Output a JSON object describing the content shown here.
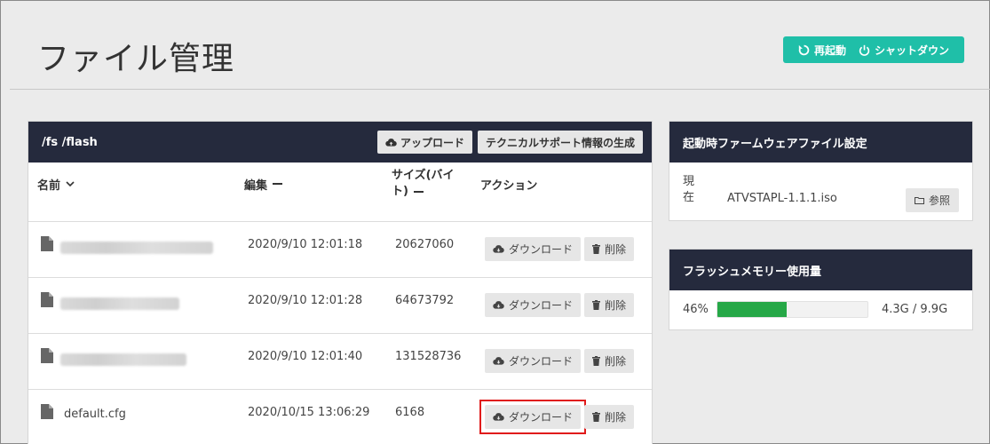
{
  "header": {
    "title": "ファイル管理",
    "restart_label": "再起動",
    "shutdown_label": "シャットダウン"
  },
  "files": {
    "path": "/fs /flash",
    "upload_label": "アップロード",
    "support_label": "テクニカルサポート情報の生成",
    "columns": {
      "name": "名前",
      "edit": "編集",
      "size_line1": "サイズ(バイ",
      "size_line2": "ト)",
      "action": "アクション"
    },
    "rows": [
      {
        "name": "",
        "date": "2020/9/10 12:01:18",
        "size": "20627060",
        "download": "ダウンロード",
        "delete": "削除"
      },
      {
        "name": "",
        "date": "2020/9/10 12:01:28",
        "size": "64673792",
        "download": "ダウンロード",
        "delete": "削除"
      },
      {
        "name": "",
        "date": "2020/9/10 12:01:40",
        "size": "131528736",
        "download": "ダウンロード",
        "delete": "削除"
      },
      {
        "name": "default.cfg",
        "date": "2020/10/15 13:06:29",
        "size": "6168",
        "download": "ダウンロード",
        "delete": "削除"
      }
    ]
  },
  "firmware": {
    "title": "起動時ファームウェアファイル設定",
    "current_label": "現在",
    "current_value": "ATVSTAPL-1.1.1.iso",
    "browse_label": "参照"
  },
  "flash": {
    "title": "フラッシュメモリー使用量",
    "percent_label": "46%",
    "percent_value": 46,
    "usage": "4.3G / 9.9G",
    "bar_color": "#26a847"
  },
  "colors": {
    "accent": "#1fbfa8",
    "panel_header": "#252a3d",
    "highlight": "#e01b1b"
  }
}
